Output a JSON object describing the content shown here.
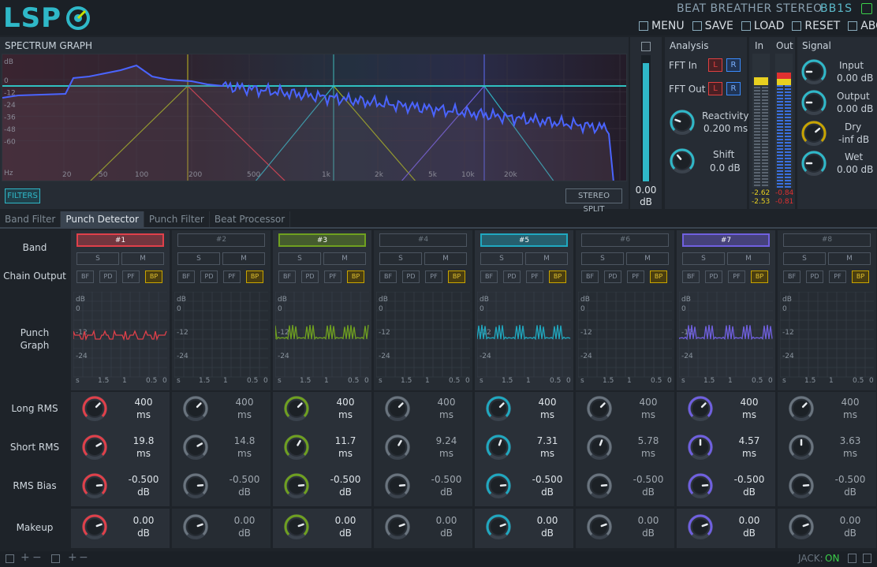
{
  "header": {
    "title": "BEAT BREATHER STEREO",
    "id": "BB1S",
    "logo": "LSP",
    "menu": [
      {
        "label": "MENU",
        "icon": "menu-icon"
      },
      {
        "label": "SAVE",
        "icon": "save-icon"
      },
      {
        "label": "LOAD",
        "icon": "load-icon"
      },
      {
        "label": "RESET",
        "icon": "reset-icon"
      },
      {
        "label": "ABOUT",
        "icon": "about-icon"
      }
    ]
  },
  "spectrum": {
    "title": "SPECTRUM GRAPH",
    "y_ticks": [
      "dB",
      "0",
      "-12",
      "-24",
      "-36",
      "-48",
      "-60",
      "Hz"
    ],
    "x_ticks": [
      "20",
      "50",
      "100",
      "200",
      "500",
      "1k",
      "2k",
      "5k",
      "10k",
      "20k"
    ],
    "filters_button": "FILTERS",
    "stereo_split_button": "STEREO SPLIT"
  },
  "zoom": {
    "value": "0.00",
    "unit": "dB"
  },
  "analysis": {
    "title": "Analysis",
    "fft_in": "FFT In",
    "fft_out": "FFT Out",
    "l": "L",
    "r": "R",
    "reactivity_label": "Reactivity",
    "reactivity_value": "0.200 ms",
    "shift_label": "Shift",
    "shift_value": "0.0 dB"
  },
  "meters": {
    "in_label": "In",
    "out_label": "Out",
    "in_values": [
      "-2.62",
      "-2.53"
    ],
    "out_values": [
      "-0.84",
      "-0.81"
    ]
  },
  "signal": {
    "title": "Signal",
    "input_label": "Input",
    "input_value": "0.00 dB",
    "output_label": "Output",
    "output_value": "0.00 dB",
    "dry_label": "Dry",
    "dry_value": "-inf dB",
    "wet_label": "Wet",
    "wet_value": "0.00 dB"
  },
  "tabs": [
    "Band Filter",
    "Punch Detector",
    "Punch Filter",
    "Beat Processor"
  ],
  "row_labels": {
    "band": "Band",
    "chain": "Chain Output",
    "punch": "Punch Graph",
    "long": "Long RMS",
    "short": "Short RMS",
    "bias": "RMS Bias",
    "makeup": "Makeup"
  },
  "graph_labels": {
    "db": "dB",
    "zero": "0",
    "m12": "-12",
    "m24": "-24",
    "x": [
      "s",
      "1.5",
      "1",
      "0.5",
      "0"
    ]
  },
  "bands": [
    {
      "name": "#1",
      "color": "#e0404a",
      "active": true,
      "s": "S",
      "m": "M",
      "long": "400",
      "long_u": "ms",
      "short": "19.8",
      "short_u": "ms",
      "bias": "-0.500",
      "bias_u": "dB",
      "makeup": "0.00",
      "makeup_u": "dB"
    },
    {
      "name": "#2",
      "color": "#8a929a",
      "active": false,
      "s": "S",
      "m": "M",
      "long": "400",
      "long_u": "ms",
      "short": "14.8",
      "short_u": "ms",
      "bias": "-0.500",
      "bias_u": "dB",
      "makeup": "0.00",
      "makeup_u": "dB"
    },
    {
      "name": "#3",
      "color": "#6fa020",
      "active": true,
      "s": "S",
      "m": "M",
      "long": "400",
      "long_u": "ms",
      "short": "11.7",
      "short_u": "ms",
      "bias": "-0.500",
      "bias_u": "dB",
      "makeup": "0.00",
      "makeup_u": "dB"
    },
    {
      "name": "#4",
      "color": "#8a929a",
      "active": false,
      "s": "S",
      "m": "M",
      "long": "400",
      "long_u": "ms",
      "short": "9.24",
      "short_u": "ms",
      "bias": "-0.500",
      "bias_u": "dB",
      "makeup": "0.00",
      "makeup_u": "dB"
    },
    {
      "name": "#5",
      "color": "#20a8c0",
      "active": true,
      "s": "S",
      "m": "M",
      "long": "400",
      "long_u": "ms",
      "short": "7.31",
      "short_u": "ms",
      "bias": "-0.500",
      "bias_u": "dB",
      "makeup": "0.00",
      "makeup_u": "dB"
    },
    {
      "name": "#6",
      "color": "#8a929a",
      "active": false,
      "s": "S",
      "m": "M",
      "long": "400",
      "long_u": "ms",
      "short": "5.78",
      "short_u": "ms",
      "bias": "-0.500",
      "bias_u": "dB",
      "makeup": "0.00",
      "makeup_u": "dB"
    },
    {
      "name": "#7",
      "color": "#7060e0",
      "active": true,
      "s": "S",
      "m": "M",
      "long": "400",
      "long_u": "ms",
      "short": "4.57",
      "short_u": "ms",
      "bias": "-0.500",
      "bias_u": "dB",
      "makeup": "0.00",
      "makeup_u": "dB"
    },
    {
      "name": "#8",
      "color": "#8a929a",
      "active": false,
      "s": "S",
      "m": "M",
      "long": "400",
      "long_u": "ms",
      "short": "3.63",
      "short_u": "ms",
      "bias": "-0.500",
      "bias_u": "dB",
      "makeup": "0.00",
      "makeup_u": "dB"
    }
  ],
  "chain_buttons": [
    "BF",
    "PD",
    "PF",
    "BP"
  ],
  "footer": {
    "jack_label": "JACK:",
    "jack_value": "ON"
  },
  "colors": {
    "accent": "#2fb8c8",
    "yellow": "#c8a400",
    "spectrum_line": "#4a64ff",
    "spectrum_line2": "#ff4040"
  }
}
